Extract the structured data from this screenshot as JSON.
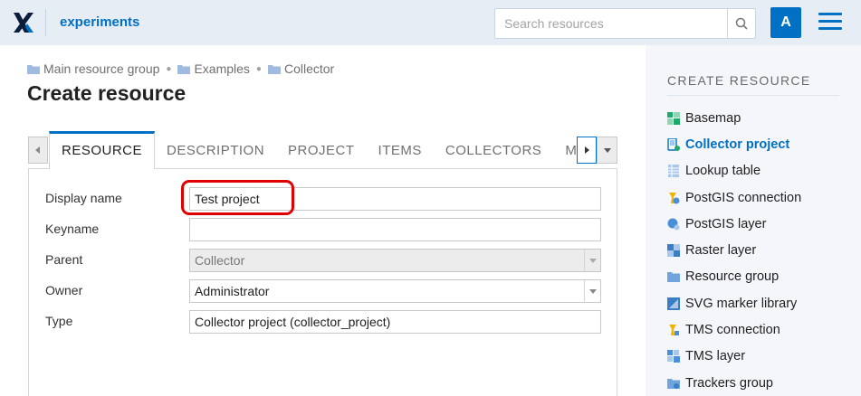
{
  "header": {
    "app_title": "experiments",
    "search_placeholder": "Search resources",
    "avatar_letter": "A"
  },
  "breadcrumb": [
    {
      "label": "Main resource group"
    },
    {
      "label": "Examples"
    },
    {
      "label": "Collector"
    }
  ],
  "page_title": "Create resource",
  "tabs": [
    {
      "label": "RESOURCE",
      "active": true
    },
    {
      "label": "DESCRIPTION"
    },
    {
      "label": "PROJECT"
    },
    {
      "label": "ITEMS"
    },
    {
      "label": "COLLECTORS"
    },
    {
      "label": "METADATA"
    }
  ],
  "form": {
    "display_name": {
      "label": "Display name",
      "value": "Test project"
    },
    "keyname": {
      "label": "Keyname",
      "value": ""
    },
    "parent": {
      "label": "Parent",
      "value": "Collector"
    },
    "owner": {
      "label": "Owner",
      "value": "Administrator"
    },
    "type": {
      "label": "Type",
      "value": "Collector project (collector_project)"
    }
  },
  "sidebar": {
    "title": "CREATE RESOURCE",
    "items": [
      {
        "label": "Basemap",
        "icon": "basemap-icon",
        "color": "#1ea86b"
      },
      {
        "label": "Collector project",
        "icon": "collector-project-icon",
        "active": true,
        "color": "#0070c5"
      },
      {
        "label": "Lookup table",
        "icon": "lookup-table-icon",
        "color": "#6fa5dc"
      },
      {
        "label": "PostGIS connection",
        "icon": "postgis-connection-icon",
        "color": "#f0b400"
      },
      {
        "label": "PostGIS layer",
        "icon": "postgis-layer-icon",
        "color": "#4a90d9"
      },
      {
        "label": "Raster layer",
        "icon": "raster-layer-icon",
        "color": "#3a7fc4"
      },
      {
        "label": "Resource group",
        "icon": "resource-group-icon",
        "color": "#6fa5dc"
      },
      {
        "label": "SVG marker library",
        "icon": "svg-marker-library-icon",
        "color": "#3a7fc4"
      },
      {
        "label": "TMS connection",
        "icon": "tms-connection-icon",
        "color": "#f0b400"
      },
      {
        "label": "TMS layer",
        "icon": "tms-layer-icon",
        "color": "#4a90d9"
      },
      {
        "label": "Trackers group",
        "icon": "trackers-group-icon",
        "color": "#6fa5dc"
      }
    ]
  }
}
